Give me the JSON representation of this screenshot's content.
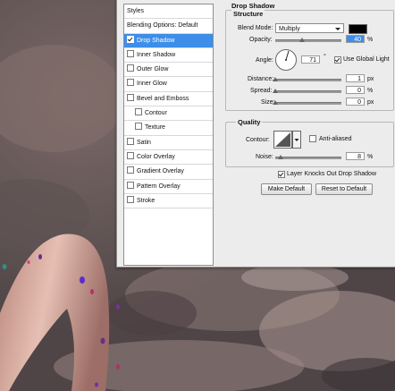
{
  "sidebar": {
    "items": [
      {
        "label": "Styles",
        "checkbox": false
      },
      {
        "label": "Blending Options: Default",
        "checkbox": false
      },
      {
        "label": "Drop Shadow",
        "checkbox": true,
        "checked": true,
        "selected": true
      },
      {
        "label": "Inner Shadow",
        "checkbox": true,
        "checked": false
      },
      {
        "label": "Outer Glow",
        "checkbox": true,
        "checked": false
      },
      {
        "label": "Inner Glow",
        "checkbox": true,
        "checked": false
      },
      {
        "label": "Bevel and Emboss",
        "checkbox": true,
        "checked": false
      },
      {
        "label": "Contour",
        "checkbox": true,
        "checked": false,
        "indent": true
      },
      {
        "label": "Texture",
        "checkbox": true,
        "checked": false,
        "indent": true
      },
      {
        "label": "Satin",
        "checkbox": true,
        "checked": false
      },
      {
        "label": "Color Overlay",
        "checkbox": true,
        "checked": false
      },
      {
        "label": "Gradient Overlay",
        "checkbox": true,
        "checked": false
      },
      {
        "label": "Pattern Overlay",
        "checkbox": true,
        "checked": false
      },
      {
        "label": "Stroke",
        "checkbox": true,
        "checked": false
      }
    ]
  },
  "panel": {
    "title": "Drop Shadow",
    "structure": {
      "heading": "Structure",
      "blend_mode_label": "Blend Mode:",
      "blend_mode_value": "Multiply",
      "shadow_color": "#000000",
      "opacity_label": "Opacity:",
      "opacity_value": "40",
      "opacity_fraction": 0.4,
      "percent": "%",
      "angle_label": "Angle:",
      "angle_value": "71",
      "degree": "°",
      "use_global_light_label": "Use Global Light",
      "use_global_light_checked": true,
      "distance_label": "Distance:",
      "distance_value": "1",
      "spread_label": "Spread:",
      "spread_value": "0",
      "size_label": "Size:",
      "size_value": "0",
      "px": "px"
    },
    "quality": {
      "heading": "Quality",
      "contour_label": "Contour:",
      "anti_aliased_label": "Anti-aliased",
      "anti_aliased_checked": false,
      "noise_label": "Noise:",
      "noise_value": "8",
      "noise_fraction": 0.08,
      "percent": "%"
    },
    "knockout_label": "Layer Knocks Out Drop Shadow",
    "knockout_checked": true,
    "make_default_label": "Make Default",
    "reset_default_label": "Reset to Default"
  },
  "colors": {
    "selection": "#3d8ee8",
    "dialog_bg": "#ececec"
  }
}
